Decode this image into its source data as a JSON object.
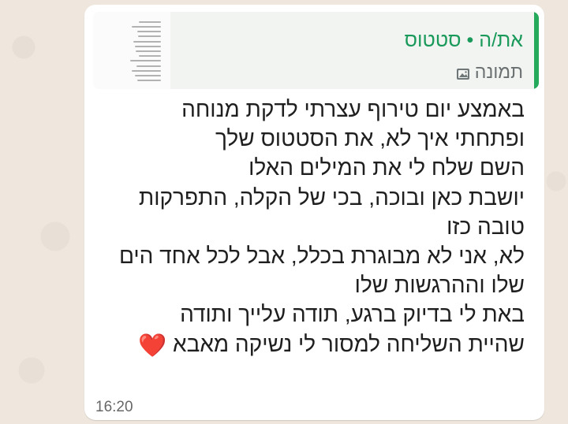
{
  "message": {
    "quote": {
      "author": "את/ה • סטטוס",
      "type_label": "תמונה",
      "icon": "photo-icon",
      "accent_color": "#25a95a"
    },
    "lines": [
      "באמצע יום טירוף עצרתי לדקת מנוחה",
      "ופתחתי איך לא, את הסטטוס שלך",
      "השם שלח לי את המילים האלו",
      "יושבת כאן ובוכה, בכי של הקלה, התפרקות",
      "טובה כזו",
      "לא, אני לא מבוגרת בכלל, אבל לכל אחד הים",
      "שלו וההרגשות שלו",
      "באת לי בדיוק ברגע, תודה עלייך ותודה",
      "שהיית השליחה למסור לי נשיקה מאבא"
    ],
    "heart_emoji": "❤️",
    "time": "16:20"
  }
}
